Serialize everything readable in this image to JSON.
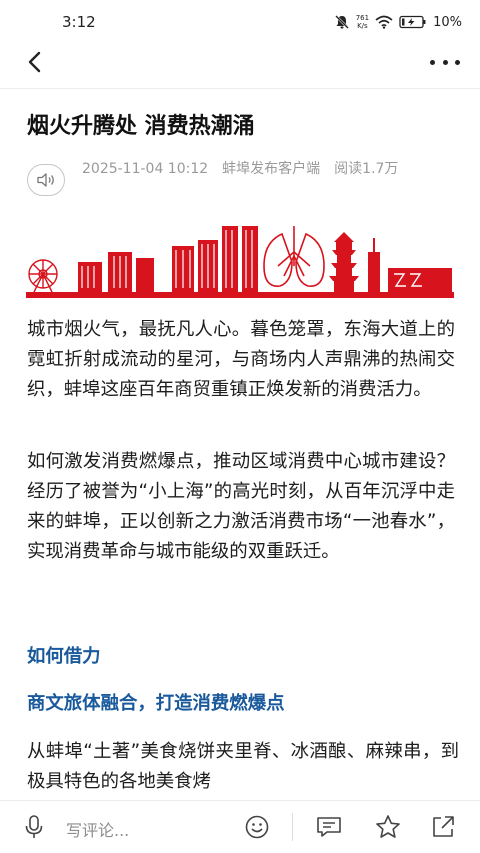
{
  "status_bar": {
    "time": "3:12",
    "net_speed_value": "761",
    "net_speed_unit": "K/s",
    "battery": "10%",
    "icons": [
      "mute-bell-icon",
      "wifi-icon",
      "battery-charging-icon"
    ]
  },
  "nav": {
    "back_icon": "chevron-left-icon",
    "more_icon": "more-dots-icon"
  },
  "article": {
    "title": "烟火升腾处 消费热潮涌",
    "meta_line": "2025-11-04 10:12　蚌埠发布客户端　阅读1.7万",
    "speaker_icon": "speaker-icon",
    "banner_color": "#d7141e",
    "paragraphs": [
      "城市烟火气，最抚凡人心。暮色笼罩，东海大道上的霓虹折射成流动的星河，与商场内人声鼎沸的热闹交织，蚌埠这座百年商贸重镇正焕发新的消费活力。",
      "如何激发消费燃爆点，推动区域消费中心城市建设？经历了被誉为“小上海”的高光时刻，从百年沉浮中走来的蚌埠，正以创新之力激活消费市场“一池春水”，实现消费革命与城市能级的双重跃迁。",
      "从蚌埠“土著”美食烧饼夹里脊、冰酒酿、麻辣串，到极具特色的各地美食烤"
    ],
    "section_headings": [
      "如何借力",
      "商文旅体融合，打造消费燃爆点"
    ],
    "heading_color": "#1a5a9c"
  },
  "bottom_bar": {
    "comment_placeholder": "写评论...",
    "icons": [
      "microphone-icon",
      "emoji-icon",
      "comment-icon",
      "star-icon",
      "share-icon"
    ]
  }
}
